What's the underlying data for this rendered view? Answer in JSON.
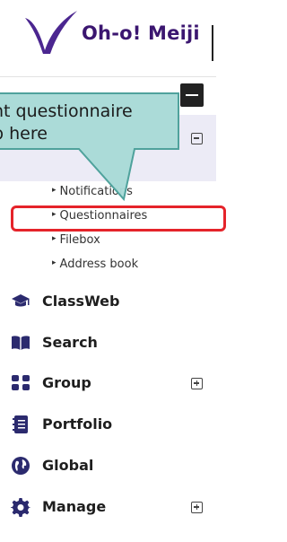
{
  "brand": {
    "name": "Oh-o! Meiji",
    "text_color": "#3b1670",
    "mark_color": "#4b2690"
  },
  "callout": {
    "lines": [
      "nt questionnaire",
      "p here"
    ],
    "fill": "#a8dad6",
    "stroke": "#4fa29c"
  },
  "submenu": {
    "items": [
      {
        "label": "Notifications"
      },
      {
        "label": "Questionnaires"
      },
      {
        "label": "Filebox"
      },
      {
        "label": "Address book"
      }
    ],
    "highlight_color": "#e5232a"
  },
  "menu": {
    "items": [
      {
        "label": "ClassWeb",
        "icon": "graduation-cap-icon",
        "expandable": false
      },
      {
        "label": "Search",
        "icon": "book-icon",
        "expandable": false
      },
      {
        "label": "Group",
        "icon": "group-icon",
        "expandable": true
      },
      {
        "label": "Portfolio",
        "icon": "portfolio-icon",
        "expandable": false
      },
      {
        "label": "Global",
        "icon": "globe-icon",
        "expandable": false
      },
      {
        "label": "Manage",
        "icon": "gear-icon",
        "expandable": true
      }
    ],
    "icon_color": "#2b2a6e"
  }
}
